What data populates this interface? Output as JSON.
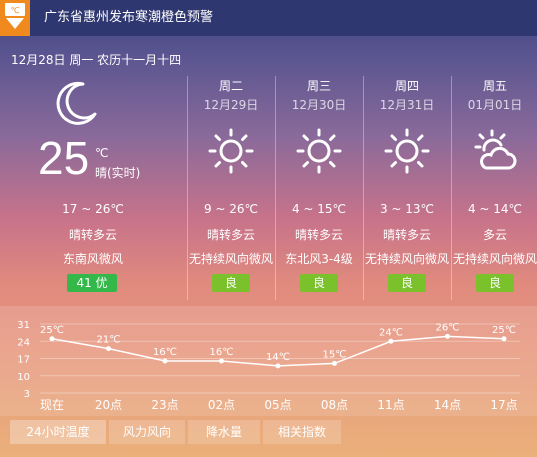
{
  "alert": {
    "icon_label": "℃",
    "title": "广东省惠州发布寒潮橙色预警"
  },
  "header": {
    "date_line": "12月28日 周一 农历十一月十四"
  },
  "today": {
    "icon": "moon-icon",
    "temp": "25",
    "unit": "℃",
    "desc": "晴(实时)",
    "range": "17 ~ 26℃",
    "weather": "晴转多云",
    "wind": "东南风微风",
    "aqi": "41 优"
  },
  "forecast": [
    {
      "day": "周二",
      "date": "12月29日",
      "icon": "sun-icon",
      "range": "9 ~ 26℃",
      "weather": "晴转多云",
      "wind": "无持续风向微风",
      "aqi": "良"
    },
    {
      "day": "周三",
      "date": "12月30日",
      "icon": "sun-icon",
      "range": "4 ~ 15℃",
      "weather": "晴转多云",
      "wind": "东北风3-4级",
      "aqi": "良"
    },
    {
      "day": "周四",
      "date": "12月31日",
      "icon": "sun-icon",
      "range": "3 ~ 13℃",
      "weather": "晴转多云",
      "wind": "无持续风向微风",
      "aqi": "良"
    },
    {
      "day": "周五",
      "date": "01月01日",
      "icon": "partly-cloudy-icon",
      "range": "4 ~ 14℃",
      "weather": "多云",
      "wind": "无持续风向微风",
      "aqi": "良"
    }
  ],
  "chart_data": {
    "type": "line",
    "x": [
      "现在",
      "20点",
      "23点",
      "02点",
      "05点",
      "08点",
      "11点",
      "14点",
      "17点"
    ],
    "series": [
      {
        "values": [
          25,
          21,
          16,
          16,
          14,
          15,
          24,
          26,
          25
        ]
      }
    ],
    "point_labels": [
      "25℃",
      "21℃",
      "16℃",
      "16℃",
      "14℃",
      "15℃",
      "24℃",
      "26℃",
      "25℃"
    ],
    "yticks": [
      31,
      24,
      17,
      10,
      3
    ],
    "ylim": [
      3,
      31
    ],
    "grid": true
  },
  "tabs": [
    "24小时温度",
    "风力风向",
    "降水量",
    "相关指数"
  ],
  "colors": {
    "alert_orange": "#f08a1e",
    "aqi_excellent": "#35b84a",
    "aqi_good": "#7ac12c"
  }
}
